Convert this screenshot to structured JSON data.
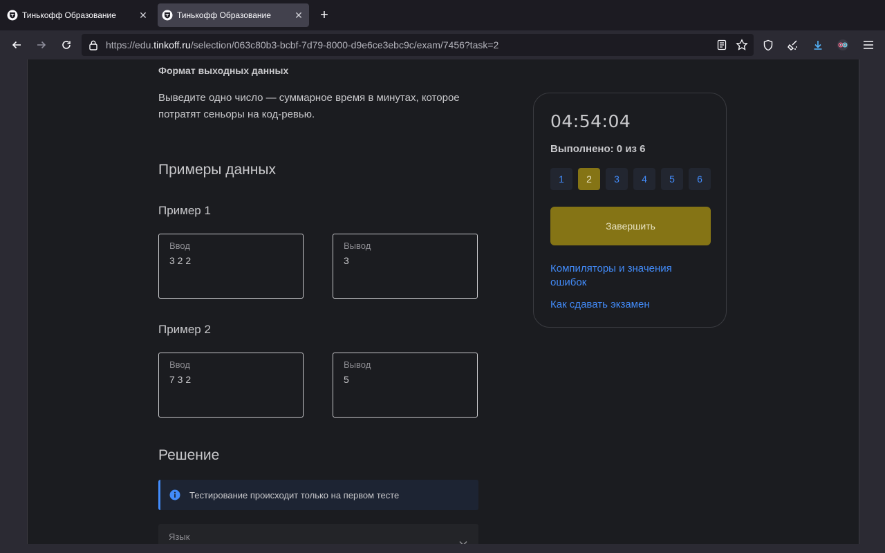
{
  "browser": {
    "tabs": [
      {
        "title": "Тинькофф Образование",
        "active": false
      },
      {
        "title": "Тинькофф Образование",
        "active": true
      }
    ],
    "url": {
      "prefix": "https://edu.",
      "host": "tinkoff.ru",
      "path": "/selection/063c80b3-bcbf-7d79-8000-d9e6ce3ebc9c/exam/7456?task=2"
    }
  },
  "main": {
    "output_format_heading": "Формат выходных данных",
    "output_format_text": "Выведите одно число — суммарное время в минутах, которое потратят сеньоры на код-ревью.",
    "examples_heading": "Примеры данных",
    "examples": [
      {
        "title": "Пример 1",
        "input_label": "Ввод",
        "input": "3 2 2",
        "output_label": "Вывод",
        "output": "3"
      },
      {
        "title": "Пример 2",
        "input_label": "Ввод",
        "input": "7 3 2",
        "output_label": "Вывод",
        "output": "5"
      }
    ],
    "solution_heading": "Решение",
    "info_text": "Тестирование происходит только на первом тесте",
    "language_label": "Язык"
  },
  "sidebar": {
    "timer": "04:54:04",
    "progress": "Выполнено: 0 из 6",
    "tasks": [
      "1",
      "2",
      "3",
      "4",
      "5",
      "6"
    ],
    "active_task": "2",
    "finish_label": "Завершить",
    "link_compilers": "Компиляторы и значения ошибок",
    "link_howto": "Как сдавать экзамен"
  },
  "colors": {
    "accent": "#857415",
    "link": "#428bf9",
    "page_bg": "#1b1c20"
  }
}
